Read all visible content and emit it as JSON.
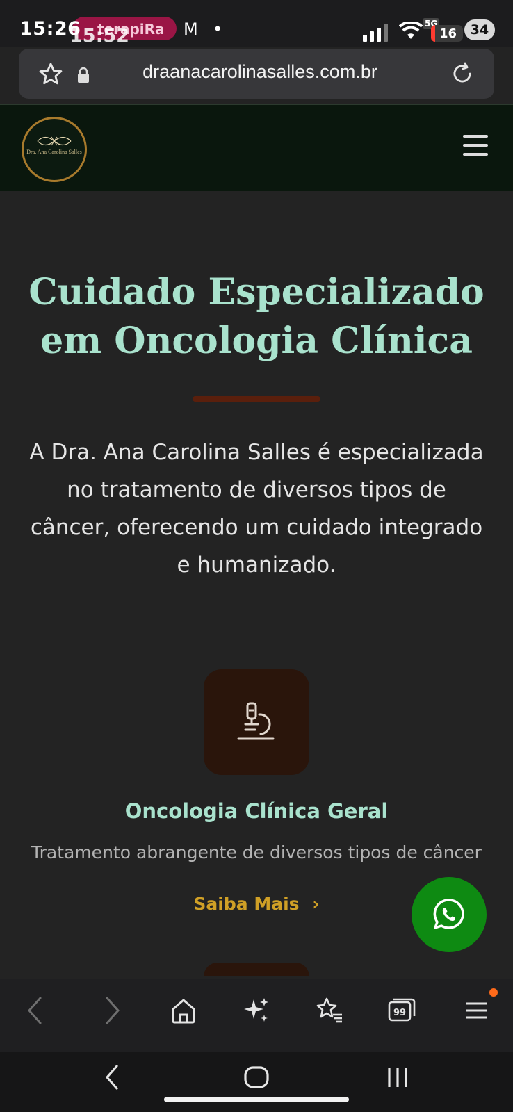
{
  "status_bar": {
    "time": "15:26",
    "overlay_time": "15:52",
    "notification_pill": "terapiRa",
    "mail_icon": "M",
    "dot": "•",
    "network": "5G",
    "battery": "16",
    "notification_count": "34"
  },
  "address_bar": {
    "url": "draanacarolinasalles.com.br",
    "icons": [
      "star-icon",
      "lock-icon",
      "reload-icon"
    ]
  },
  "header": {
    "logo_text": "Dra. Ana Carolina Salles",
    "menu_icon": "hamburger-icon"
  },
  "hero": {
    "title_line1": "Cuidado Especializado",
    "title_line2": "em Oncologia Clínica",
    "text_line1": "A Dra. Ana Carolina Salles é especializada",
    "text_line2": "no tratamento de diversos tipos de",
    "text_line3": "câncer, oferecendo um cuidado integrado",
    "text_line4": "e humanizado."
  },
  "service_card": {
    "icon": "microscope-icon",
    "title": "Oncologia Clínica Geral",
    "description": "Tratamento abrangente de diversos tipos de câncer",
    "link": "Saiba Mais",
    "link_chevron": "›"
  },
  "floating": {
    "icon": "whatsapp-icon"
  },
  "toolbar": {
    "icons": [
      "back-icon",
      "forward-icon",
      "home-icon",
      "sparkle-icon",
      "bookmarks-icon",
      "tabs-icon",
      "menu-icon"
    ],
    "tabs_count": "99"
  },
  "colors": {
    "background": "#232323",
    "header": "#0a170d",
    "accent_mint": "#a9e2cd",
    "accent_gold": "#d0a026",
    "whatsapp": "#0e8a12"
  }
}
